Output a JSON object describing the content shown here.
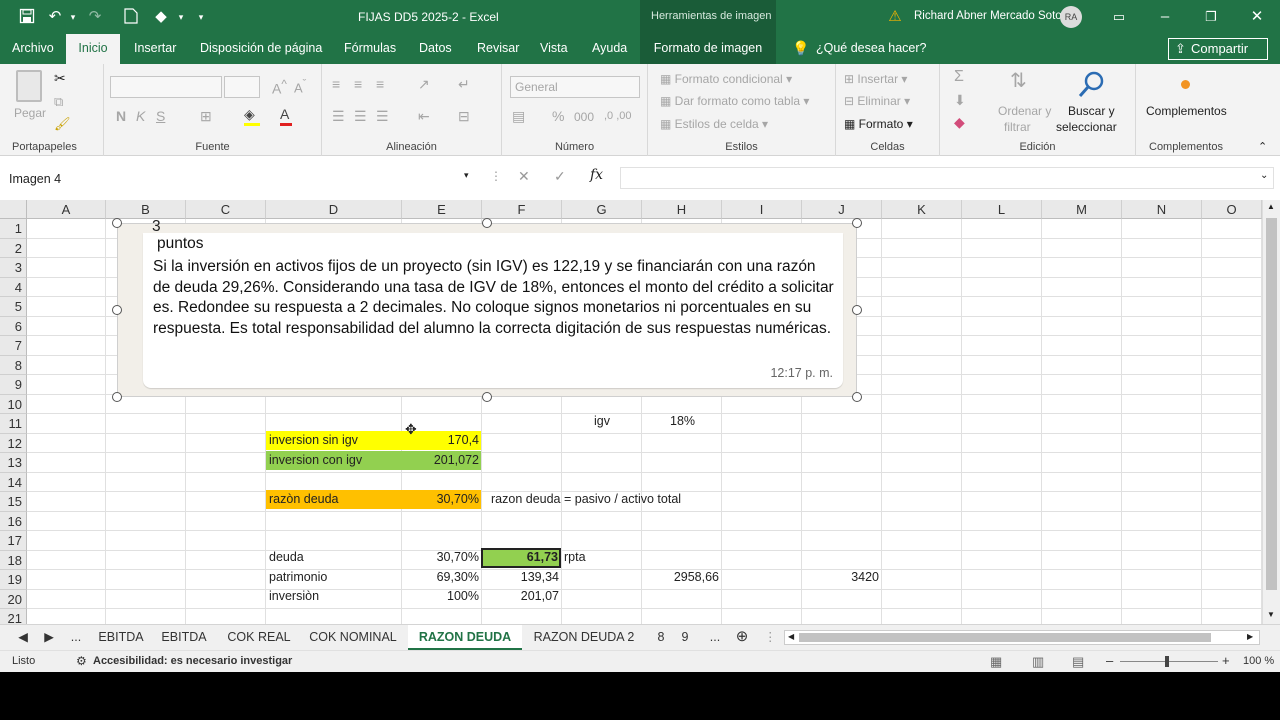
{
  "title": {
    "doc": "FIJAS DD5 2025-2  -  Excel",
    "context": "Herramientas de imagen",
    "user": "Richard Abner Mercado Soto",
    "initials": "RA"
  },
  "tabs": {
    "archivo": "Archivo",
    "inicio": "Inicio",
    "insertar": "Insertar",
    "disposicion": "Disposición de página",
    "formulas": "Fórmulas",
    "datos": "Datos",
    "revisar": "Revisar",
    "vista": "Vista",
    "ayuda": "Ayuda",
    "formato": "Formato de imagen",
    "tell": "¿Qué desea hacer?",
    "share": "Compartir"
  },
  "ribbon": {
    "portapapeles": "Portapapeles",
    "pegar": "Pegar",
    "fuente": "Fuente",
    "alineacion": "Alineación",
    "numero": "Número",
    "general": "General",
    "estilos": "Estilos",
    "formato_cond": "Formato condicional",
    "dar_formato": "Dar formato como tabla",
    "estilos_celda": "Estilos de celda",
    "celdas": "Celdas",
    "insertar": "Insertar",
    "eliminar": "Eliminar",
    "formato": "Formato",
    "edicion": "Edición",
    "ordenar1": "Ordenar y",
    "ordenar2": "filtrar",
    "buscar1": "Buscar y",
    "buscar2": "seleccionar",
    "complementos": "Complementos",
    "complementos_grp": "Complementos"
  },
  "namebox": "Imagen 4",
  "columns": [
    "A",
    "B",
    "C",
    "D",
    "E",
    "F",
    "G",
    "H",
    "I",
    "J",
    "K",
    "L",
    "M",
    "N",
    "O"
  ],
  "rows": [
    "1",
    "2",
    "3",
    "4",
    "5",
    "6",
    "7",
    "8",
    "9",
    "10",
    "11",
    "12",
    "13",
    "14",
    "15",
    "16",
    "17",
    "18",
    "19",
    "20",
    "21"
  ],
  "cells": {
    "g11": "igv",
    "h11": "18%",
    "d12": "inversion sin igv",
    "e12": "170,4",
    "d13": "inversion con igv",
    "e13": "201,072",
    "d15": "razòn deuda",
    "e15": "30,70%",
    "f15": "razon deuda = pasivo / activo total",
    "d18": "deuda",
    "e18": "30,70%",
    "f18": "61,73",
    "g18": "rpta",
    "d19": "patrimonio",
    "e19": "69,30%",
    "f19": "139,34",
    "h19": "2958,66",
    "j19": "3420",
    "d20": "inversiòn",
    "e20": "100%",
    "f20": "201,07"
  },
  "image": {
    "line0": "3",
    "line1": "puntos",
    "body": "Si la inversión en activos fijos de un proyecto (sin IGV) es 122,19 y se financiarán con una razón de deuda 29,26%. Considerando una tasa de IGV de 18%, entonces el monto del crédito a solicitar es. Redondee su respuesta a 2 decimales. No coloque signos monetarios ni porcentuales en su respuesta. Es total responsabilidad del alumno la correcta digitación de sus respuestas numéricas.",
    "time": "12:17 p. m."
  },
  "sheets": {
    "more": "...",
    "s1": "EBITDA",
    "s2": "EBITDA",
    "s3": "COK REAL",
    "s4": "COK NOMINAL",
    "s5": "RAZON DEUDA",
    "s6": "RAZON DEUDA 2",
    "s7": "8",
    "s8": "9",
    "more2": "..."
  },
  "status": {
    "ready": "Listo",
    "access": "Accesibilidad: es necesario investigar",
    "zoom": "100 %"
  },
  "colors": {
    "excel_green": "#217346",
    "yellow": "#ffff00",
    "light_green": "#92d050",
    "orange": "#ffc000"
  }
}
